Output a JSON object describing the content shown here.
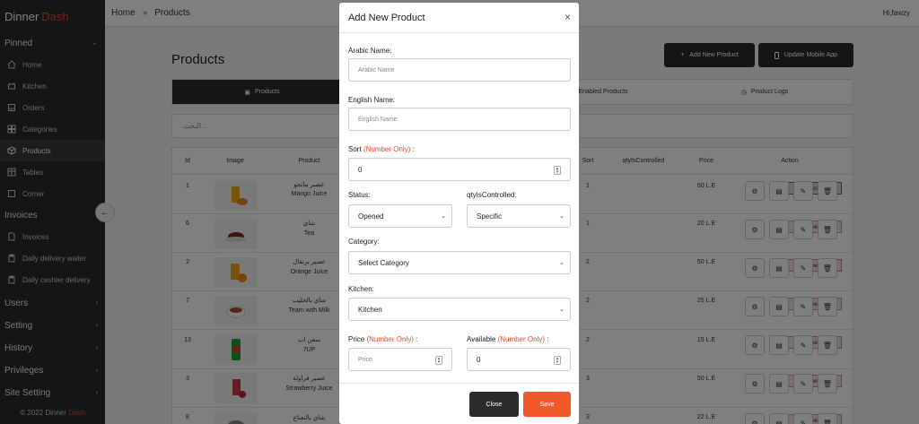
{
  "sidebar": {
    "brand_a": "Dinner",
    "brand_b": "Dash",
    "pinned": "Pinned",
    "items": [
      {
        "label": "Home",
        "icon": "home-icon"
      },
      {
        "label": "Kitchen",
        "icon": "kitchen-icon"
      },
      {
        "label": "Orders",
        "icon": "inbox-icon"
      },
      {
        "label": "Categories",
        "icon": "grid-icon"
      },
      {
        "label": "Products",
        "icon": "cube-icon"
      },
      {
        "label": "Tables",
        "icon": "table-icon"
      },
      {
        "label": "Corner",
        "icon": "square-icon"
      }
    ],
    "invoices": "Invoices",
    "invoice_items": [
      {
        "label": "Invoices",
        "icon": "file-icon"
      },
      {
        "label": "Daily delivery waiter",
        "icon": "clipboard-icon"
      },
      {
        "label": "Daily cashier delivery",
        "icon": "clipboard-icon"
      }
    ],
    "sections": [
      "Users",
      "Setting",
      "History",
      "Privileges",
      "Site Setting"
    ],
    "footer_a": "© 2022 Dinner",
    "footer_b": "Dash"
  },
  "topbar": {
    "home": "Home",
    "sep": "»",
    "current": "Products",
    "user": "Hi,fawzy"
  },
  "main": {
    "title": "Products",
    "add_button": "Add New Product",
    "update_button": "Update Mobile App",
    "tabs": [
      "Products",
      "Enabled Products",
      "Product Logs"
    ],
    "search_placeholder": "البحث...",
    "columns": [
      "Id",
      "Image",
      "Product",
      "Sort",
      "qtyIsControlled",
      "Price",
      "Action"
    ],
    "rows": [
      {
        "id": "1",
        "ar": "عصير مانجو",
        "en": "Mango Juice",
        "sort": "1",
        "qty": "Specific",
        "price": "50 L.E"
      },
      {
        "id": "6",
        "ar": "شاي",
        "en": "Tea",
        "sort": "1",
        "qty": "Not_Specified",
        "price": "20 L.E"
      },
      {
        "id": "2",
        "ar": "عصير برتقال",
        "en": "Orange Juice",
        "sort": "2",
        "qty": "Not_Specified",
        "price": "50 L.E"
      },
      {
        "id": "7",
        "ar": "شاي بالحليب",
        "en": "Team with Milk",
        "sort": "2",
        "qty": "Not_Specified",
        "price": "25 L.E"
      },
      {
        "id": "13",
        "ar": "سفن اب",
        "en": "7UP",
        "sort": "2",
        "qty": "Not_Specified",
        "price": "15 L.E"
      },
      {
        "id": "3",
        "ar": "عصير فراولة",
        "en": "Strawberry Juice",
        "sort": "3",
        "qty": "Not_Specified",
        "price": "50 L.E"
      },
      {
        "id": "8",
        "ar": "شاي بالنعناع",
        "en": "",
        "sort": "3",
        "qty": "Not_Specified",
        "price": "22 L.E"
      }
    ]
  },
  "modal": {
    "title": "Add New Product",
    "arabic_label": "Arabic Name:",
    "arabic_placeholder": "Arabic Name",
    "english_label": "English Name:",
    "english_placeholder": "English Name",
    "sort_label": "Sort",
    "sort_hint": "(Number Only)",
    "sort_suffix": ":",
    "sort_value": "0",
    "status_label": "Status:",
    "status_value": "Opened",
    "qty_label": "qtyIsControlled:",
    "qty_value": "Specific",
    "category_label": "Category:",
    "category_value": "Select Category",
    "kitchen_label": "Kitchen:",
    "kitchen_value": "Kitchen",
    "price_label": "Price",
    "price_hint": "(Number Only)",
    "price_suffix": ":",
    "price_placeholder": "Price",
    "available_label": "Available",
    "available_hint": "(Number Only)",
    "available_suffix": ":",
    "available_value": "0",
    "close_button": "Close",
    "save_button": "Save"
  },
  "colors": {
    "accent": "#e8482a",
    "dark": "#2b2b2b"
  }
}
